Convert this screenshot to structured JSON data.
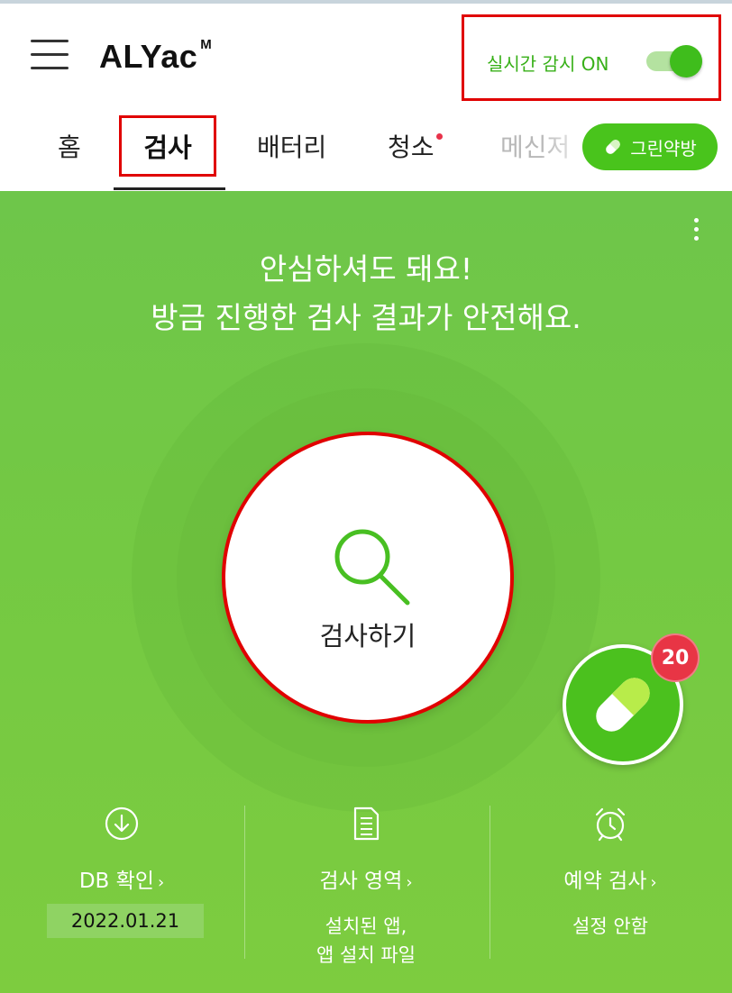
{
  "header": {
    "logo": "ALYac",
    "logo_sup": "M",
    "realtime_label": "실시간 감시 ON",
    "realtime_on": true
  },
  "tabs": [
    {
      "label": "홈"
    },
    {
      "label": "검사",
      "selected": true
    },
    {
      "label": "배터리"
    },
    {
      "label": "청소",
      "has_dot": true
    },
    {
      "label": "메신저"
    }
  ],
  "green_pharmacy_label": "그린약방",
  "main": {
    "headline_line1": "안심하셔도 돼요!",
    "headline_line2": "방금 진행한 검사 결과가 안전해요.",
    "scan_label": "검사하기",
    "pill_badge": "20"
  },
  "bottom": {
    "db": {
      "title": "DB 확인",
      "chevron": "›",
      "value": "2022.01.21"
    },
    "area": {
      "title": "검사 영역",
      "chevron": "›",
      "value_line1": "설치된 앱,",
      "value_line2": "앱 설치 파일"
    },
    "schedule": {
      "title": "예약 검사",
      "chevron": "›",
      "value": "설정 안함"
    }
  },
  "colors": {
    "accent_green": "#49c41c",
    "highlight_red": "#e00000",
    "badge_red": "#e83545"
  },
  "icons": [
    "menu-icon",
    "pill-icon",
    "kebab-menu-icon",
    "search-icon",
    "download-icon",
    "document-icon",
    "alarm-clock-icon"
  ]
}
